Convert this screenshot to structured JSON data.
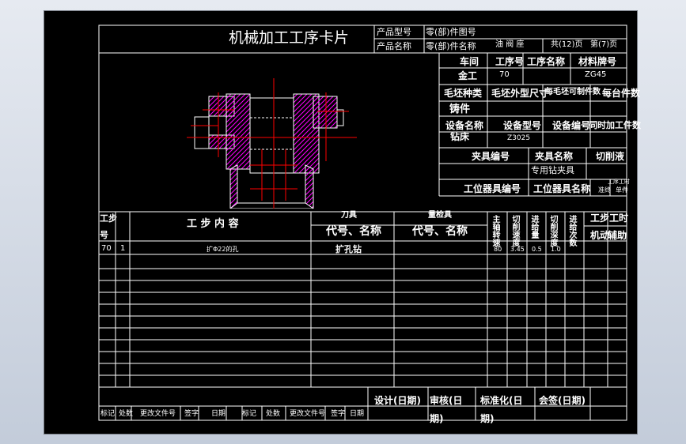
{
  "card": {
    "title": "机械加工工序卡片",
    "product_model_label": "产品型号",
    "part_drawing_no_label": "零(部)件图号",
    "product_name_label": "产品名称",
    "part_name_label": "零(部)件名称",
    "part_name_value": "油  阀  座",
    "total_pages": "共(12)页",
    "page_no": "第(7)页"
  },
  "info": {
    "workshop_label": "车间",
    "operation_no_label": "工序号",
    "operation_name_label": "工序名称",
    "material_label": "材料牌号",
    "workshop_value": "金工",
    "operation_no_value": "70",
    "material_value": "ZG45",
    "blank_type_label": "毛坯种类",
    "blank_size_label": "毛坯外型尺寸",
    "pieces_per_blank_label": "每毛坯可制件数",
    "pieces_per_unit_label": "每台件数",
    "blank_type_value": "铸件",
    "equipment_name_label": "设备名称",
    "equipment_model_label": "设备型号",
    "equipment_no_label": "设备编号",
    "simultaneous_label": "同时加工件数",
    "equipment_name_value": "钻床",
    "equipment_model_value": "Z3025",
    "fixture_no_label": "夹具编号",
    "fixture_name_label": "夹具名称",
    "coolant_label": "切削液",
    "fixture_name_value": "专用钻夹具",
    "station_tool_no_label": "工位器具编号",
    "station_tool_name_label": "工位器具名称",
    "time_label": "工序工时",
    "time_standard": "准终",
    "time_unit": "单件"
  },
  "steps": {
    "step_no_label_a": "工步",
    "step_no_label_b": "号",
    "content_label": "工 步 内 容",
    "tool_label": "刀具",
    "tool_code_label": "代号、名称",
    "gauge_label": "量检具",
    "gauge_code_label": "代号、名称",
    "spindle_speed_label": "主轴转速",
    "cutting_speed_label": "切削速度",
    "feed_label": "进给量",
    "depth_label": "切削深度",
    "passes_label": "进给次数",
    "step_time_label": "工步工时",
    "machine_time_label": "机动",
    "aux_time_label": "辅助",
    "rows": [
      {
        "op": "70",
        "step": "1",
        "content": "扩Φ22的孔",
        "tool": "扩孔钻",
        "gauge": "",
        "n": "80",
        "v": "3.45",
        "f": "0.5",
        "ap": "1.0",
        "passes": "",
        "machine": "",
        "aux": ""
      }
    ]
  },
  "signatures": {
    "design": "设计(日期)",
    "review": "审核(日期)",
    "standard": "标准化(日期)",
    "countersign": "会签(日期)",
    "mark": "标记",
    "count": "处数",
    "change_doc": "更改文件号",
    "sign": "签字",
    "date": "日期"
  },
  "colors": {
    "hatch": "#ff00ff",
    "center": "#ff0000",
    "ink": "#ffffff",
    "sheet": "#000000"
  }
}
